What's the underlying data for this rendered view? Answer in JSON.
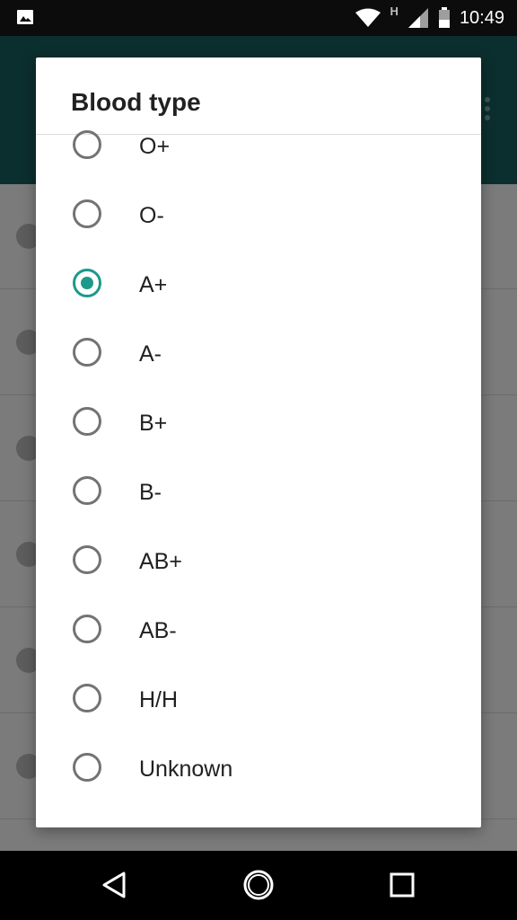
{
  "status_bar": {
    "time": "10:49",
    "network_label": "H",
    "icons": [
      "image-notification-icon",
      "wifi-icon",
      "cell-signal-icon",
      "battery-icon"
    ]
  },
  "dialog": {
    "title": "Blood type",
    "selected": "A+",
    "options": [
      {
        "label": "O+",
        "checked": false
      },
      {
        "label": "O-",
        "checked": false
      },
      {
        "label": "A+",
        "checked": true
      },
      {
        "label": "A-",
        "checked": false
      },
      {
        "label": "B+",
        "checked": false
      },
      {
        "label": "B-",
        "checked": false
      },
      {
        "label": "AB+",
        "checked": false
      },
      {
        "label": "AB-",
        "checked": false
      },
      {
        "label": "H/H",
        "checked": false
      },
      {
        "label": "Unknown",
        "checked": false
      }
    ]
  },
  "nav_bar": {
    "icons": [
      "back-icon",
      "home-icon",
      "recents-icon"
    ]
  },
  "colors": {
    "accent": "#1b9a8a",
    "toolbar": "#0b2f2e",
    "scrim": "#7b7b7b"
  }
}
